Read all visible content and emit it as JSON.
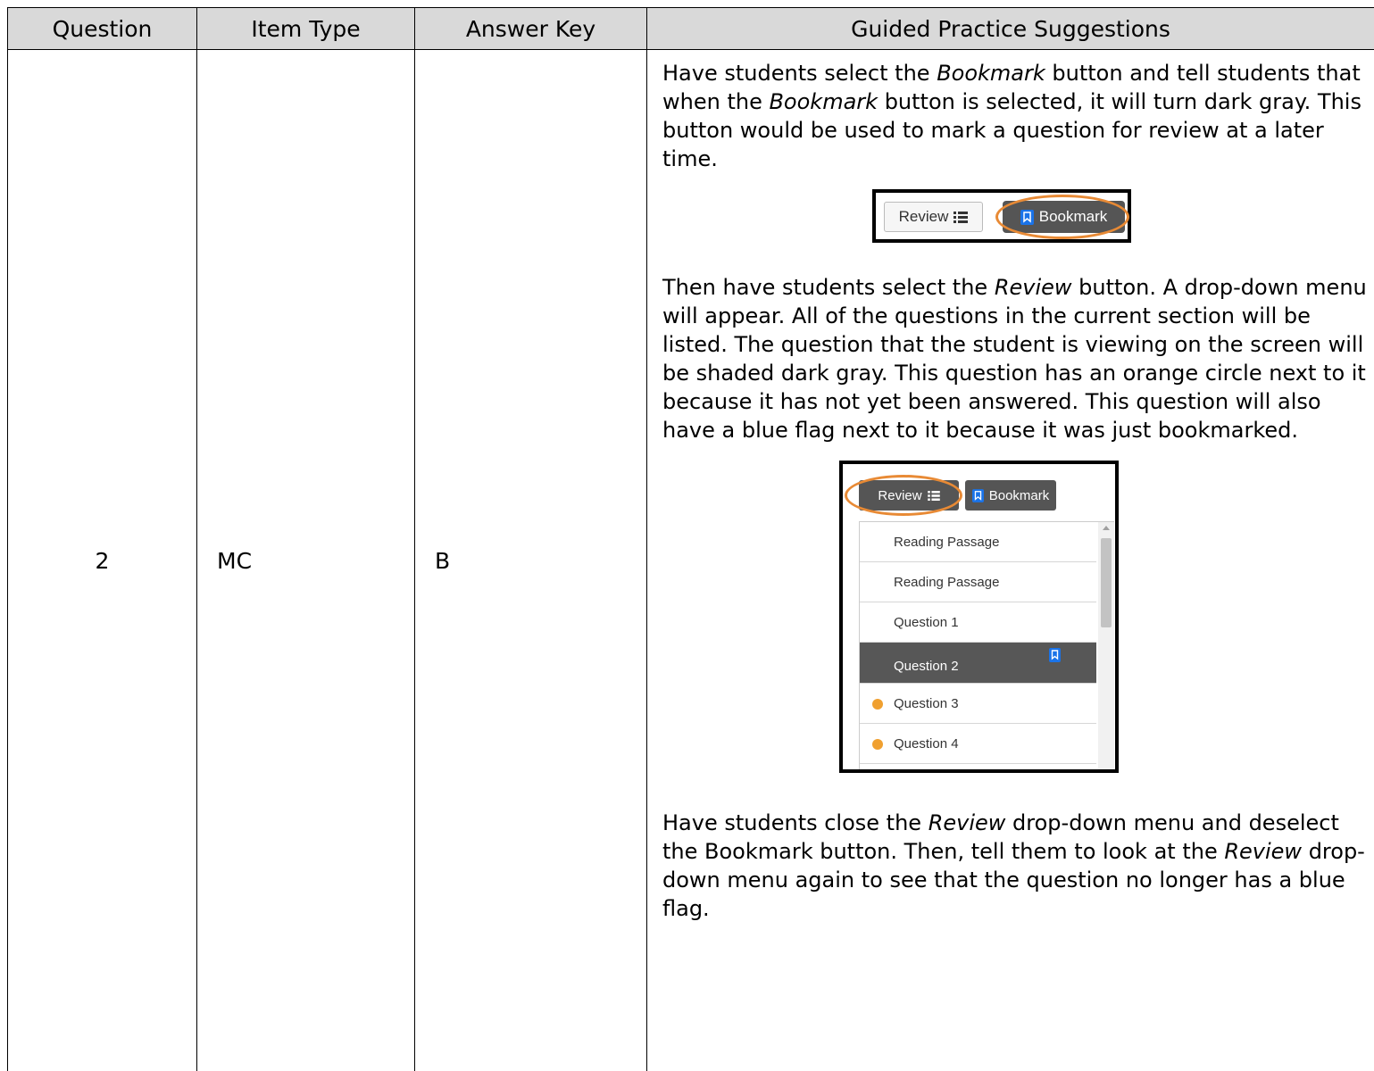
{
  "table": {
    "headers": [
      "Question",
      "Item Type",
      "Answer Key",
      "Guided Practice Suggestions"
    ],
    "row": {
      "question": "2",
      "item_type": "MC",
      "answer_key": "B",
      "guidance": {
        "p1": {
          "a": "Have students select the ",
          "b": "Bookmark",
          "c": " button and tell students that when the ",
          "d": "Bookmark",
          "e": " button is selected, it will turn dark gray.  This button would be used to mark a question for review at a later time."
        },
        "p2": {
          "a": "Then have students select the ",
          "b": "Review",
          "c": " button.   A drop-down menu will appear.  All of the questions in the current section will be listed.  The question that the student is viewing on the screen will be shaded dark gray.  This question has an orange circle next to it because it has not yet been answered.  This question will also have a blue flag next to it because it was just bookmarked."
        },
        "p3": {
          "a": "Have students close the ",
          "b": "Review",
          "c": " drop-down menu and deselect the Bookmark button. Then, tell them to look at the ",
          "d": "Review",
          "e": " drop-down menu again to see that the question no longer has a blue flag."
        }
      }
    }
  },
  "screenshot1": {
    "review_label": "Review",
    "bookmark_label": "Bookmark",
    "list_icon": "list-icon",
    "bookmark_icon": "bookmark-icon",
    "highlight_color": "#e88a35"
  },
  "screenshot2": {
    "review_label": "Review",
    "bookmark_label": "Bookmark",
    "items": [
      {
        "label": "Reading Passage",
        "state": "normal"
      },
      {
        "label": "Reading Passage",
        "state": "normal"
      },
      {
        "label": "Question 1",
        "state": "normal"
      },
      {
        "label": "Question 2",
        "state": "current-bookmarked"
      },
      {
        "label": "Question 3",
        "state": "unanswered"
      },
      {
        "label": "Question 4",
        "state": "unanswered"
      }
    ],
    "unanswered_color": "#f0a030",
    "flag_color": "#1a73e8"
  }
}
